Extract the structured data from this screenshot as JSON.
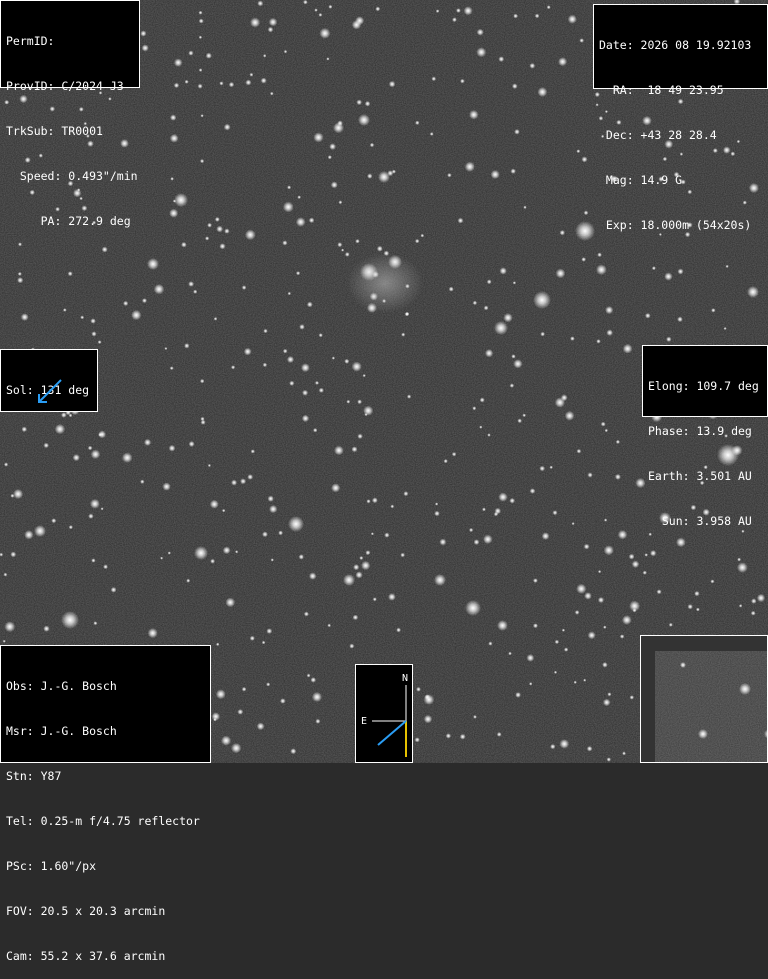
{
  "panel_ids": {
    "rows": [
      "PermID:",
      "ProvID: C/2024 J3",
      "TrkSub: TR0001",
      "  Speed: 0.493\"/min",
      "     PA: 272.9 deg"
    ]
  },
  "panel_date": {
    "rows": [
      "Date: 2026 08 19.92103",
      "  RA:  18 49 23.95",
      " Dec: +43 28 28.4",
      " Mag: 14.9 G",
      " Exp: 18.000m (54x20s)"
    ]
  },
  "panel_sol": {
    "label": "Sol: 131 deg",
    "arrow_color": "#2a9df4",
    "angle_deg": 131
  },
  "panel_elong": {
    "rows": [
      "Elong: 109.7 deg",
      "Phase: 13.9 deg",
      "Earth: 3.501 AU",
      "  Sun: 3.958 AU"
    ]
  },
  "panel_obs": {
    "rows": [
      "Obs: J.-G. Bosch",
      "Msr: J.-G. Bosch",
      "Stn: Y87",
      "Tel: 0.25-m f/4.75 reflector",
      "PSc: 1.60\"/px",
      "FOV: 20.5 x 20.3 arcmin",
      "Cam: 55.2 x 37.6 arcmin"
    ]
  },
  "compass": {
    "north_label": "N",
    "east_label": "E",
    "motion_color": "#2a9df4",
    "north_color": "#e6c200"
  }
}
